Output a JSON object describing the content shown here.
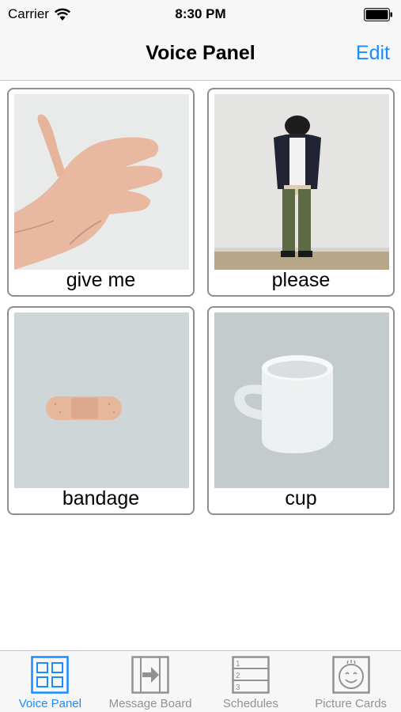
{
  "status_bar": {
    "carrier": "Carrier",
    "time": "8:30 PM"
  },
  "nav": {
    "title": "Voice Panel",
    "edit_label": "Edit"
  },
  "cards": [
    {
      "label": "give me",
      "image": "open-hand-photo"
    },
    {
      "label": "please",
      "image": "bowing-person-photo"
    },
    {
      "label": "bandage",
      "image": "bandage-photo"
    },
    {
      "label": "cup",
      "image": "cup-photo"
    }
  ],
  "tabs": [
    {
      "label": "Voice Panel",
      "icon": "voice-panel-icon",
      "active": true
    },
    {
      "label": "Message Board",
      "icon": "message-board-icon",
      "active": false
    },
    {
      "label": "Schedules",
      "icon": "schedules-icon",
      "active": false
    },
    {
      "label": "Picture Cards",
      "icon": "picture-cards-icon",
      "active": false
    }
  ],
  "colors": {
    "accent": "#1a8cff",
    "inactive": "#929292",
    "bar_bg": "#f7f7f7",
    "card_border": "#8e8e8e"
  }
}
